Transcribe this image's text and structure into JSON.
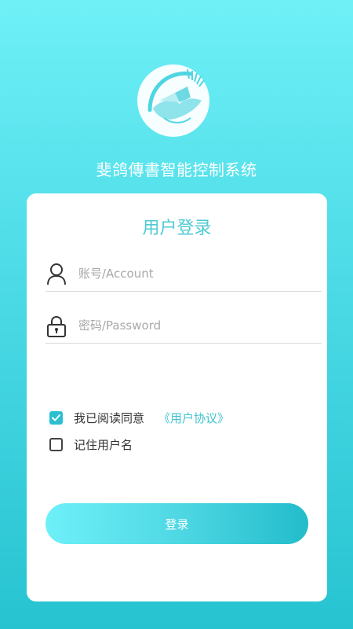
{
  "app": {
    "title": "斐鸽傳書智能控制系统"
  },
  "login": {
    "heading": "用户登录",
    "account_placeholder": "账号/Account",
    "password_placeholder": "密码/Password",
    "agree_label": "我已阅读同意",
    "agreement_link": "《用户协议》",
    "agree_checked": true,
    "remember_label": "记住用户名",
    "remember_checked": false,
    "submit_label": "登录"
  },
  "colors": {
    "accent": "#2bbfcf",
    "heading": "#4ecad4",
    "background_top": "#6ff0f7",
    "background_bottom": "#27c3d1"
  }
}
